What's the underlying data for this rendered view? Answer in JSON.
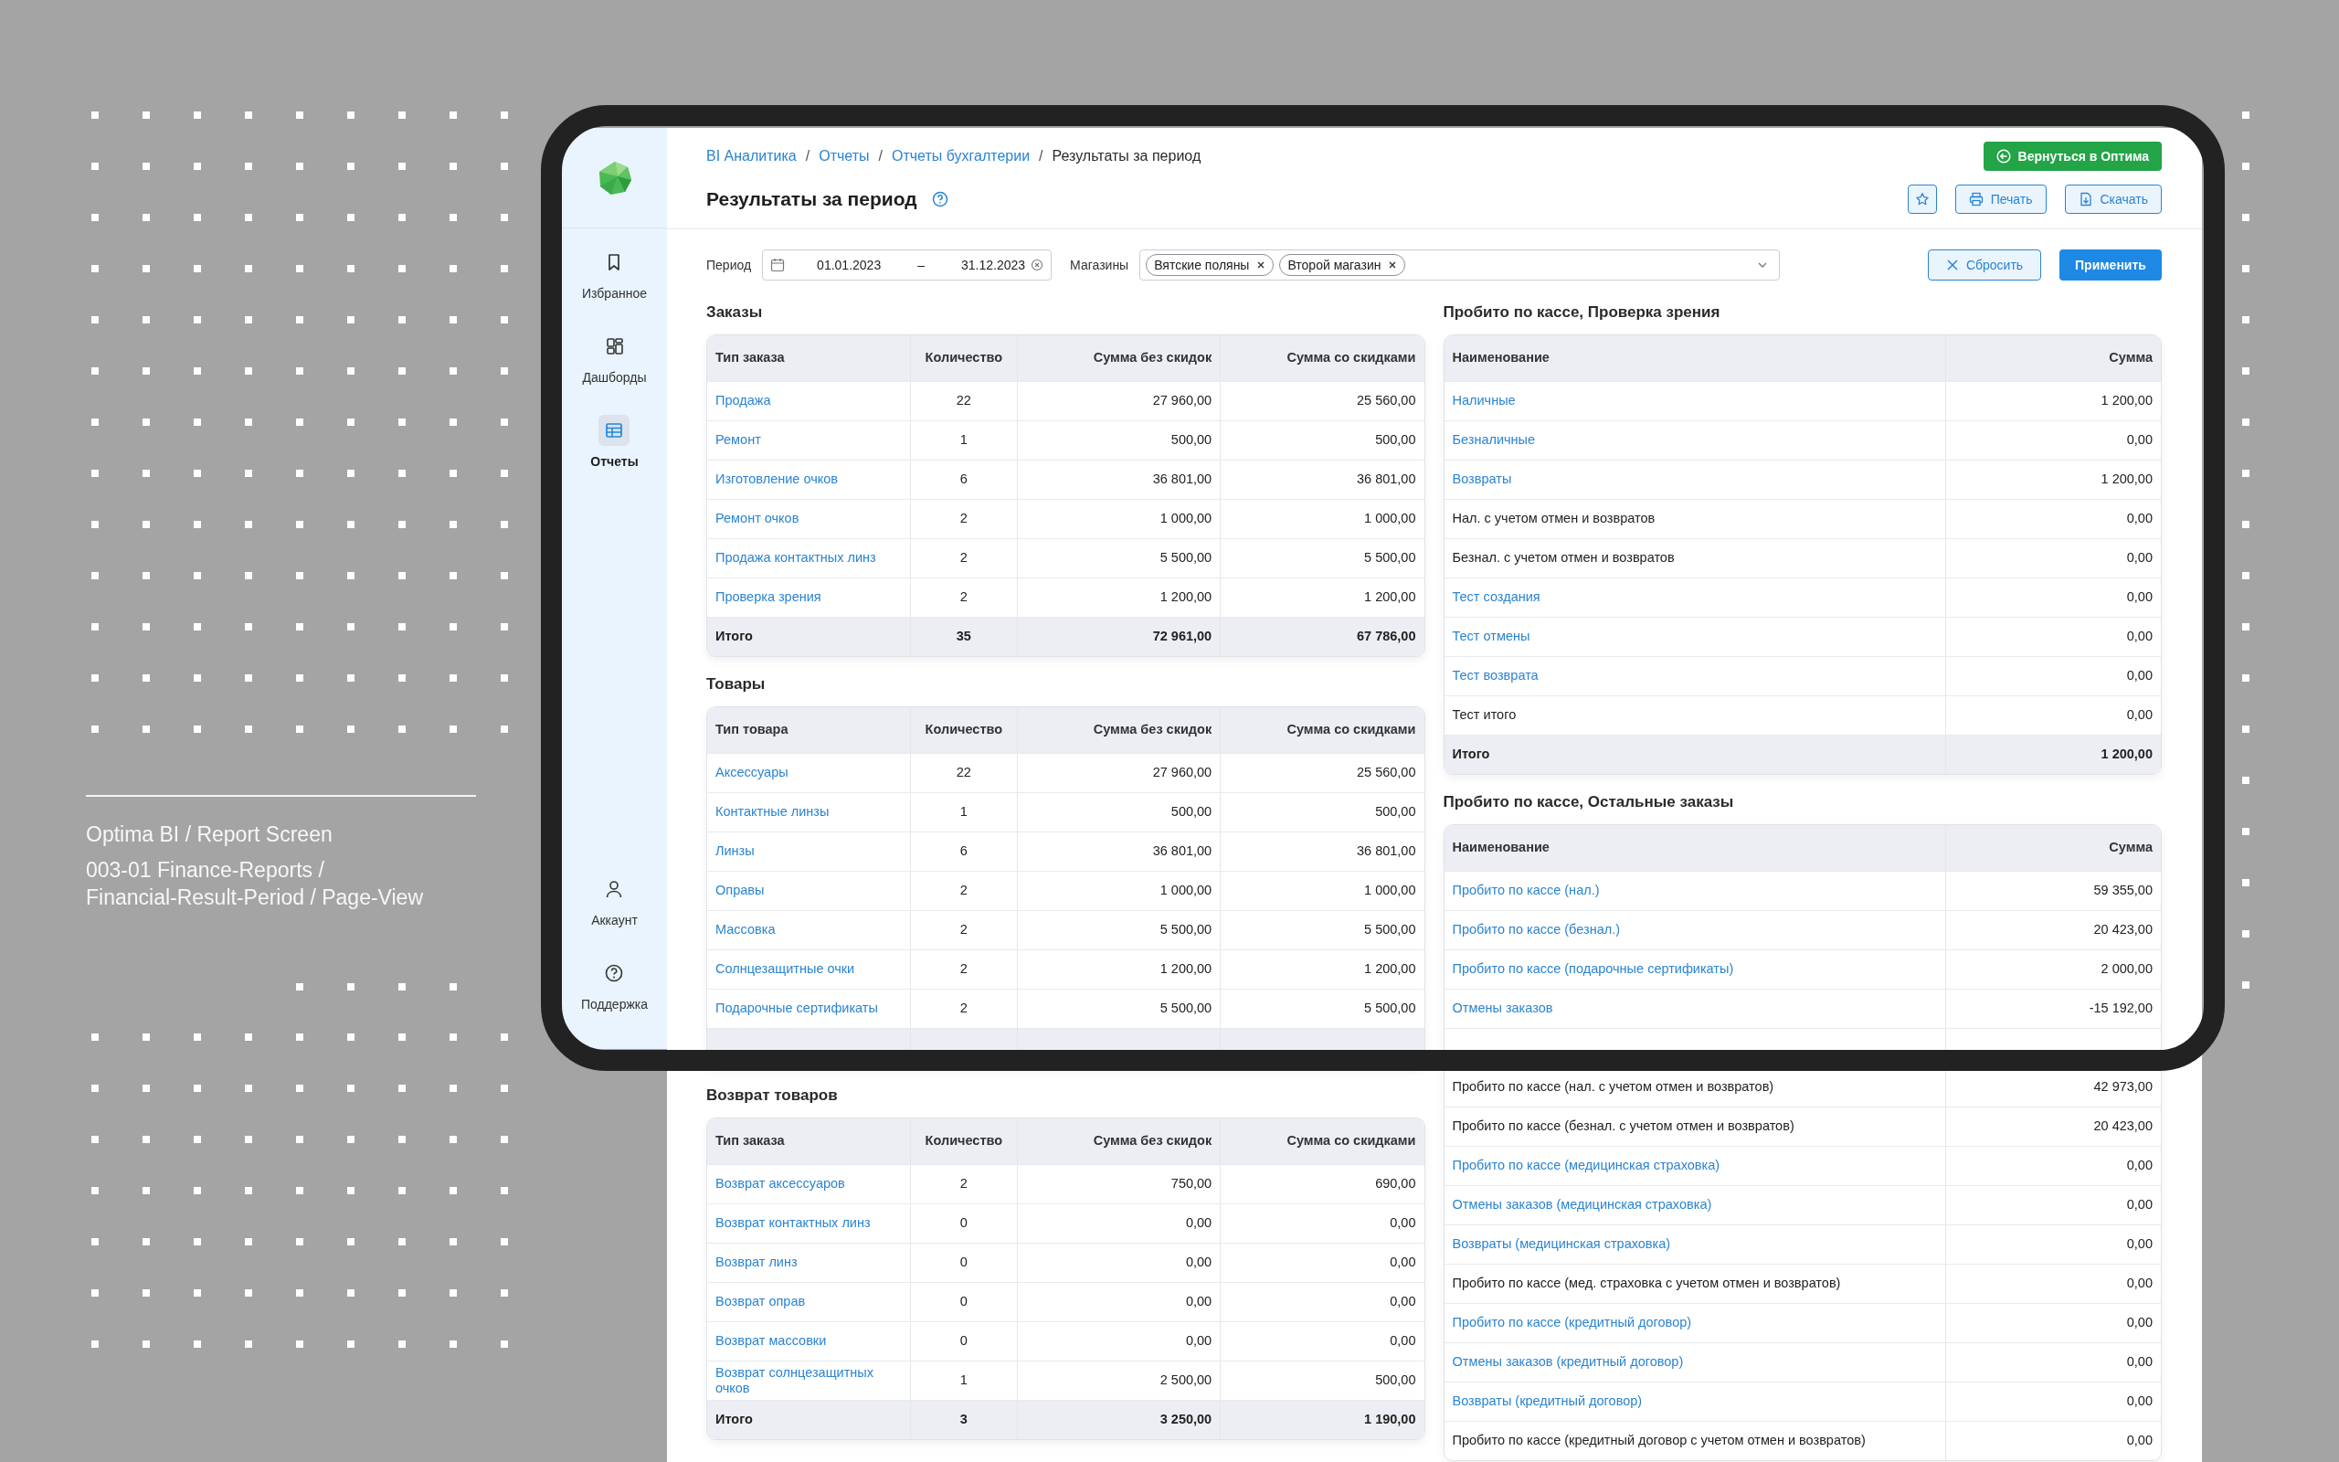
{
  "caption": {
    "title": "Optima BI / Report Screen",
    "lines": [
      "003-01 Finance-Reports /",
      "Financial-Result-Period / Page-View"
    ]
  },
  "sidebar": {
    "items": [
      {
        "label": "Избранное",
        "kind": "bookmark",
        "selected": false
      },
      {
        "label": "Дашборды",
        "kind": "dashboard",
        "selected": false
      },
      {
        "label": "Отчеты",
        "kind": "table",
        "selected": true
      }
    ],
    "bottom_items": [
      {
        "label": "Аккаунт",
        "kind": "user",
        "selected": false
      },
      {
        "label": "Поддержка",
        "kind": "help",
        "selected": false
      }
    ]
  },
  "breadcrumb_separator": "/",
  "breadcrumbs": [
    {
      "label": "BI Аналитика",
      "current": false
    },
    {
      "label": "Отчеты",
      "current": false
    },
    {
      "label": "Отчеты бухгалтерии",
      "current": false
    },
    {
      "label": "Результаты за период",
      "current": true
    }
  ],
  "title": "Результаты за период",
  "back_button": "Вернуться в Оптима",
  "toolbar": [
    {
      "kind": "star"
    },
    {
      "kind": "print",
      "label": "Печать"
    },
    {
      "kind": "download",
      "label": "Скачать"
    }
  ],
  "filters": {
    "period_label": "Период",
    "date_from": "01.01.2023",
    "date_separator": "–",
    "date_to": "31.12.2023",
    "stores_label": "Магазины",
    "stores": [
      "Вятские поляны",
      "Второй магазин"
    ],
    "reset": "Сбросить",
    "apply": "Применить"
  },
  "left_sections": [
    {
      "title": "Заказы",
      "columns": [
        "Тип заказа",
        "Количество",
        "Сумма без скидок",
        "Сумма со скидками"
      ],
      "rows": [
        {
          "cells": [
            "Продажа",
            "22",
            "27 960,00",
            "25 560,00"
          ],
          "link": true
        },
        {
          "cells": [
            "Ремонт",
            "1",
            "500,00",
            "500,00"
          ],
          "link": true
        },
        {
          "cells": [
            "Изготовление очков",
            "6",
            "36 801,00",
            "36 801,00"
          ],
          "link": true
        },
        {
          "cells": [
            "Ремонт очков",
            "2",
            "1 000,00",
            "1 000,00"
          ],
          "link": true
        },
        {
          "cells": [
            "Продажа контактных линз",
            "2",
            "5 500,00",
            "5 500,00"
          ],
          "link": true
        },
        {
          "cells": [
            "Проверка зрения",
            "2",
            "1 200,00",
            "1 200,00"
          ],
          "link": true
        }
      ],
      "total": [
        "Итого",
        "35",
        "72 961,00",
        "67 786,00"
      ]
    },
    {
      "title": "Товары",
      "columns": [
        "Тип товара",
        "Количество",
        "Сумма без скидок",
        "Сумма со скидками"
      ],
      "rows": [
        {
          "cells": [
            "Аксессуары",
            "22",
            "27 960,00",
            "25 560,00"
          ],
          "link": true
        },
        {
          "cells": [
            "Контактные линзы",
            "1",
            "500,00",
            "500,00"
          ],
          "link": true
        },
        {
          "cells": [
            "Линзы",
            "6",
            "36 801,00",
            "36 801,00"
          ],
          "link": true
        },
        {
          "cells": [
            "Оправы",
            "2",
            "1 000,00",
            "1 000,00"
          ],
          "link": true
        },
        {
          "cells": [
            "Массовка",
            "2",
            "5 500,00",
            "5 500,00"
          ],
          "link": true
        },
        {
          "cells": [
            "Солнцезащитные очки",
            "2",
            "1 200,00",
            "1 200,00"
          ],
          "link": true
        },
        {
          "cells": [
            "Подарочные сертификаты",
            "2",
            "5 500,00",
            "5 500,00"
          ],
          "link": true
        },
        {
          "kind": "blank_total"
        }
      ]
    },
    {
      "title": "Возврат товаров",
      "columns": [
        "Тип заказа",
        "Количество",
        "Сумма без скидок",
        "Сумма со скидками"
      ],
      "rows": [
        {
          "cells": [
            "Возврат аксессуаров",
            "2",
            "750,00",
            "690,00"
          ],
          "link": true
        },
        {
          "cells": [
            "Возврат контактных линз",
            "0",
            "0,00",
            "0,00"
          ],
          "link": true
        },
        {
          "cells": [
            "Возврат линз",
            "0",
            "0,00",
            "0,00"
          ],
          "link": true
        },
        {
          "cells": [
            "Возврат оправ",
            "0",
            "0,00",
            "0,00"
          ],
          "link": true
        },
        {
          "cells": [
            "Возврат массовки",
            "0",
            "0,00",
            "0,00"
          ],
          "link": true
        },
        {
          "cells": [
            "Возврат солнцезащитных очков",
            "1",
            "2 500,00",
            "500,00"
          ],
          "link": true
        }
      ],
      "total": [
        "Итого",
        "3",
        "3 250,00",
        "1 190,00"
      ]
    }
  ],
  "right_sections": [
    {
      "title": "Пробито по кассе, Проверка зрения",
      "columns": [
        "Наименование",
        "Сумма"
      ],
      "rows": [
        {
          "cells": [
            "Наличные",
            "1 200,00"
          ],
          "link": true
        },
        {
          "cells": [
            "Безналичные",
            "0,00"
          ],
          "link": true
        },
        {
          "cells": [
            "Возвраты",
            "1 200,00"
          ],
          "link": true
        },
        {
          "cells": [
            "Нал. с учетом отмен и возвратов",
            "0,00"
          ],
          "link": false
        },
        {
          "cells": [
            "Безнал. с учетом отмен и возвратов",
            "0,00"
          ],
          "link": false
        },
        {
          "cells": [
            "Тест создания",
            "0,00"
          ],
          "link": true
        },
        {
          "cells": [
            "Тест отмены",
            "0,00"
          ],
          "link": true
        },
        {
          "cells": [
            "Тест возврата",
            "0,00"
          ],
          "link": true
        },
        {
          "cells": [
            "Тест итого",
            "0,00"
          ],
          "link": false
        }
      ],
      "total": [
        "Итого",
        "1 200,00"
      ]
    },
    {
      "title": "Пробито по кассе, Остальные заказы",
      "columns": [
        "Наименование",
        "Сумма"
      ],
      "rows": [
        {
          "cells": [
            "Пробито по кассе (нал.)",
            "59 355,00"
          ],
          "link": true
        },
        {
          "cells": [
            "Пробито по кассе (безнал.)",
            "20 423,00"
          ],
          "link": true
        },
        {
          "cells": [
            "Пробито по кассе (подарочные сертификаты)",
            "2 000,00"
          ],
          "link": true
        },
        {
          "cells": [
            "Отмены заказов",
            "-15 192,00"
          ],
          "link": true
        },
        {
          "kind": "blank"
        },
        {
          "cells": [
            "Пробито по кассе (нал. с учетом отмен и возвратов)",
            "42 973,00"
          ],
          "link": false
        },
        {
          "cells": [
            "Пробито по кассе (безнал. с учетом отмен и возвратов)",
            "20 423,00"
          ],
          "link": false
        },
        {
          "cells": [
            "Пробито по кассе (медицинская страховка)",
            "0,00"
          ],
          "link": true
        },
        {
          "cells": [
            "Отмены заказов (медицинская страховка)",
            "0,00"
          ],
          "link": true
        },
        {
          "cells": [
            "Возвраты (медицинская страховка)",
            "0,00"
          ],
          "link": true
        },
        {
          "cells": [
            "Пробито по кассе (мед. страховка с учетом отмен и возвратов)",
            "0,00"
          ],
          "link": false
        },
        {
          "cells": [
            "Пробито по кассе (кредитный договор)",
            "0,00"
          ],
          "link": true
        },
        {
          "cells": [
            "Отмены заказов (кредитный договор)",
            "0,00"
          ],
          "link": true
        },
        {
          "cells": [
            "Возвраты (кредитный договор)",
            "0,00"
          ],
          "link": true
        },
        {
          "cells": [
            "Пробито по кассе (кредитный договор с учетом отмен и возвратов)",
            "0,00"
          ],
          "link": false
        }
      ]
    }
  ]
}
